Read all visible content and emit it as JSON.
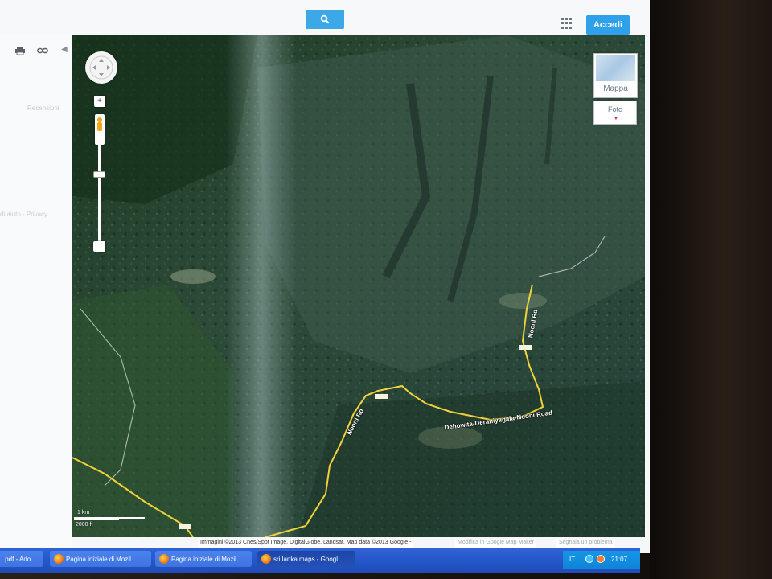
{
  "header": {
    "search_icon": "magnifier-icon",
    "apps_icon": "apps-grid-icon",
    "signin_label": "Accedi"
  },
  "left_panel": {
    "print_icon": "print-icon",
    "link_icon": "link-icon",
    "collapse_icon": "chevron-left-icon",
    "faint_text_1": "Recensioni",
    "faint_text_2": "di aiuto - Privacy"
  },
  "map": {
    "type_buttons": {
      "map_label": "Mappa",
      "photo_label": "Foto"
    },
    "controls": {
      "pan_icon": "pan-arrows-icon",
      "zoom_in_label": "+",
      "pegman_icon": "pegman-icon"
    },
    "road_labels": [
      "Nooni Rd",
      "Nooni Rd",
      "Dehowita-Deraniyagala-Nooni Road"
    ],
    "scale": {
      "metric": "1 km",
      "imperial": "2000 ft"
    },
    "attribution": "Immagini ©2013 Cnes/Spot Image, DigitalGlobe, Landsat, Map data ©2013 Google -",
    "links": [
      "Modifica in Google Map Maker",
      "Segnala un problema"
    ],
    "colors": {
      "road": "#f2d23a",
      "vegetation_dark": "#203a2a",
      "vegetation_light": "#4e6e4e"
    }
  },
  "taskbar": {
    "items": [
      {
        "label": ".pdf - Ado..."
      },
      {
        "label": "Pagina iniziale di Mozil..."
      },
      {
        "label": "Pagina iniziale di Mozil..."
      },
      {
        "label": "sri lanka maps - Googl..."
      }
    ],
    "language": "IT",
    "time": "21:07",
    "colors": {
      "bar": "#2557c9",
      "tray": "#0f84d8"
    }
  }
}
